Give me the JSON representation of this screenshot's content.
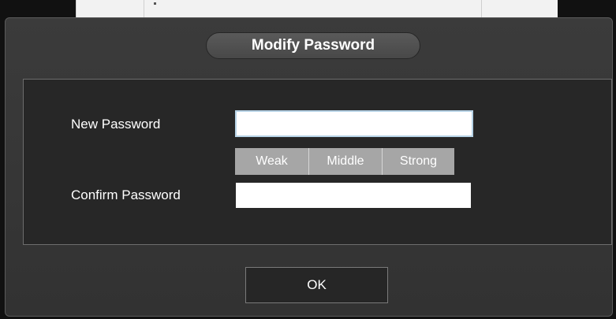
{
  "dialog": {
    "title": "Modify Password",
    "new_password_label": "New Password",
    "new_password_value": "",
    "confirm_password_label": "Confirm Password",
    "confirm_password_value": "",
    "strength_levels": [
      "Weak",
      "Middle",
      "Strong"
    ],
    "ok_label": "OK"
  },
  "colors": {
    "dialog_background": "#353535",
    "inner_panel": "#272727",
    "strength_segment": "#a6a6a6",
    "text": "#ffffff",
    "focus_border": "#b7d3e6"
  }
}
